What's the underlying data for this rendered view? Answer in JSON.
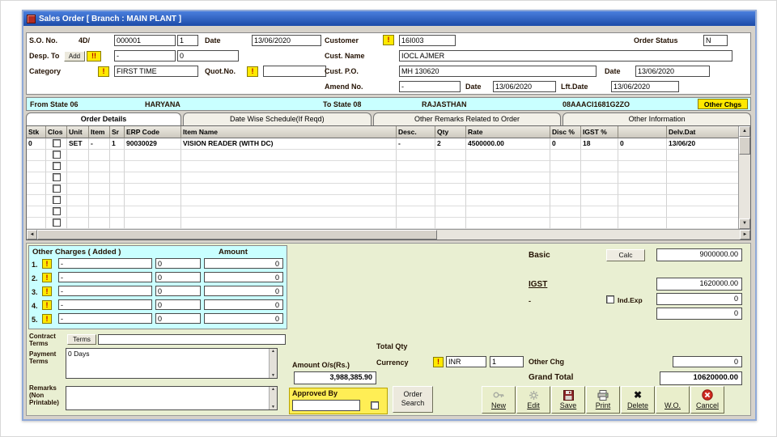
{
  "icons": {
    "up": "▲",
    "down": "▼",
    "left": "◄",
    "right": "►",
    "excl": "!",
    "excl2": "!!",
    "delete_x": "✖"
  },
  "window": {
    "title": "Sales Order [ Branch : MAIN PLANT ]"
  },
  "form": {
    "so_no_label": "S.O. No.",
    "so_prefix": "4D/",
    "so_number": "000001",
    "so_rev": "1",
    "date_label": "Date",
    "date_value": "13/06/2020",
    "customer_label": "Customer",
    "customer_code": "16I003",
    "order_status_label": "Order Status",
    "order_status_value": "N",
    "desp_to_label": "Desp. To",
    "add_button": "Add",
    "desp_value1": "-",
    "desp_value2": "0",
    "cust_name_label": "Cust. Name",
    "cust_name_value": "IOCL AJMER",
    "category_label": "Category",
    "category_value": "FIRST TIME",
    "quot_no_label": "Quot.No.",
    "quot_no_value": "",
    "cust_po_label": "Cust. P.O.",
    "cust_po_value": "MH 130620",
    "po_date_label": "Date",
    "po_date_value": "13/06/2020",
    "amend_no_label": "Amend No.",
    "amend_no_value": "-",
    "amend_date_label": "Date",
    "amend_date_value": "13/06/2020",
    "eff_date_label": "Lft.Date",
    "eff_date_value": "13/06/2020"
  },
  "states": {
    "from_label": "From State 06",
    "from_value": "HARYANA",
    "to_label": "To State 08",
    "to_value": "RAJASTHAN",
    "gstin": "08AAACI1681G2ZO",
    "other_chgs_button": "Other Chgs"
  },
  "tabs": [
    "Order Details",
    "Date Wise Schedule(If Reqd)",
    "Other Remarks Related to Order",
    "Other Information"
  ],
  "table": {
    "columns": [
      "Stk",
      "Clos",
      "Unit",
      "Item",
      "Sr",
      "ERP Code",
      "Item Name",
      "Desc.",
      "Qty",
      "Rate",
      "Disc %",
      "IGST %",
      "",
      "Delv.Dat"
    ],
    "row1": {
      "stk": "0",
      "unit": "SET",
      "item": "-",
      "sr": "1",
      "erp": "90030029",
      "name": "VISION READER (WITH DC)",
      "desc": "-",
      "qty": "2",
      "rate": "4500000.00",
      "disc": "0",
      "igst": "18",
      "cess": "0",
      "delv": "13/06/20"
    }
  },
  "other_charges": {
    "title": "Other Charges ( Added )",
    "amount_header": "Amount",
    "rows": [
      {
        "num": "1.",
        "sel": "-",
        "val": "0",
        "amount": "0"
      },
      {
        "num": "2.",
        "sel": "-",
        "val": "0",
        "amount": "0"
      },
      {
        "num": "3.",
        "sel": "-",
        "val": "0",
        "amount": "0"
      },
      {
        "num": "4.",
        "sel": "-",
        "val": "0",
        "amount": "0"
      },
      {
        "num": "5.",
        "sel": "-",
        "val": "0",
        "amount": "0"
      }
    ]
  },
  "terms": {
    "contract_label": "Contract Terms",
    "terms_button": "Terms",
    "contract_value": "",
    "payment_label": "Payment Terms",
    "payment_value": "0 Days",
    "remarks_label": "Remarks (Non Printable)",
    "remarks_value": ""
  },
  "totals": {
    "basic_label": "Basic",
    "calc_button": "Calc",
    "basic_value": "9000000.00",
    "igst_label": "IGST",
    "igst_value": "1620000.00",
    "misc_label": "-",
    "ind_exp_label": "Ind.Exp",
    "misc_value": "0",
    "extra_value": "0",
    "total_qty_label": "Total Qty",
    "currency_label": "Currency",
    "currency_code": "INR",
    "currency_rate": "1",
    "other_chg_label": "Other Chg",
    "other_chg_value": "0",
    "grand_total_label": "Grand Total",
    "grand_total_value": "10620000.00",
    "amount_os_label": "Amount O/s(Rs.)",
    "amount_os_value": "3,988,385.90",
    "approved_by_label": "Approved By",
    "approved_by_value": ""
  },
  "actions": {
    "order_search": "Order Search",
    "new": "New",
    "edit": "Edit",
    "save": "Save",
    "print": "Print",
    "delete": "Delete",
    "wo": "W.O.",
    "cancel": "Cancel"
  }
}
